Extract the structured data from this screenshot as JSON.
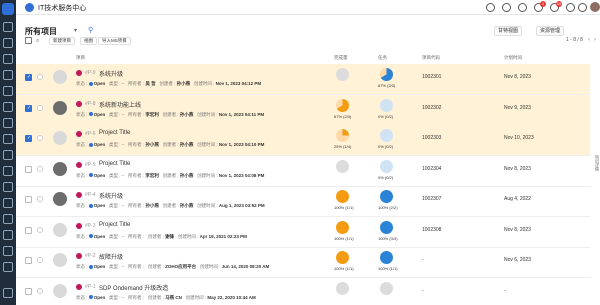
{
  "app": {
    "title": "IT技术服务中心"
  },
  "topbar": {
    "badge_1": "1",
    "badge_2": "10"
  },
  "header": {
    "title": "所有项目",
    "buttons": {
      "dashboard": "甘特视图",
      "resource": "资源管理"
    },
    "actions": {
      "new": "新建项目",
      "view": "视图",
      "import": "导入MS项目"
    },
    "pager": "1 - 8 / 8"
  },
  "columns": {
    "item": "项目",
    "progress": "完成量",
    "tasks": "任务",
    "code": "项目代码",
    "date": "计划时间"
  },
  "rows": [
    {
      "id": "#P-9",
      "title": "系统升级",
      "status": "Open",
      "type": "类型",
      "owner_label": "所有者",
      "owner": "吴 哲",
      "creator_label": "创建者",
      "creator": "孙小燕",
      "created_label": "创建时间",
      "created": "Nov 1, 2023 04:12 PM",
      "progress": "",
      "tasks": "67% (2/3)",
      "code": "1002301",
      "date": "Nov 8, 2023"
    },
    {
      "id": "#P-8",
      "title": "系统新功能上线",
      "status": "Open",
      "type": "类型",
      "owner_label": "所有者",
      "owner": "李宏利",
      "creator_label": "创建者",
      "creator": "孙小燕",
      "created_label": "创建时间",
      "created": "Nov 1, 2023 04:11 PM",
      "progress": "67% (2/3)",
      "tasks": "0% (0/2)",
      "code": "1002302",
      "date": "Nov 9, 2023"
    },
    {
      "id": "#P-6",
      "title": "Project Title",
      "status": "Open",
      "type": "类型",
      "owner_label": "所有者",
      "owner": "孙小燕",
      "creator_label": "创建者",
      "creator": "孙小燕",
      "created_label": "创建时间",
      "created": "Nov 1, 2023 04:10 PM",
      "progress": "25% (1/4)",
      "tasks": "0% (0/2)",
      "code": "1002303",
      "date": "Nov 10, 2023"
    },
    {
      "id": "#P-5",
      "title": "Project Title",
      "status": "Open",
      "type": "类型",
      "owner_label": "所有者",
      "owner": "李宏利",
      "creator_label": "创建者",
      "creator": "孙小燕",
      "created_label": "创建时间",
      "created": "Nov 1, 2023 04:08 PM",
      "progress": "",
      "tasks": "0% (0/2)",
      "code": "1002304",
      "date": "Nov 8, 2023"
    },
    {
      "id": "#P-4",
      "title": "系统升级",
      "status": "Open",
      "type": "类型",
      "owner_label": "所有者",
      "owner": "孙小燕",
      "creator_label": "创建者",
      "creator": "孙小燕",
      "created_label": "创建时间",
      "created": "Aug 1, 2023 03:52 PM",
      "progress": "100% (1/1)",
      "tasks": "100% (2/2)",
      "code": "1002307",
      "date": "Aug 4, 2022"
    },
    {
      "id": "#P-3",
      "title": "Project Title",
      "status": "Open",
      "type": "类型",
      "owner_label": "所有者",
      "owner": "",
      "creator_label": "创建者",
      "creator": "谢锋",
      "created_label": "创建时间",
      "created": "Apr 19, 2021 02:23 PM",
      "progress": "100% (1/1)",
      "tasks": "100% (3/3)",
      "code": "1002308",
      "date": "Nov 8, 2023"
    },
    {
      "id": "#P-2",
      "title": "故障升级",
      "status": "Open",
      "type": "类型",
      "owner_label": "所有者",
      "owner": "",
      "creator_label": "创建者",
      "creator": "ZOHO应用平台",
      "created_label": "创建时间",
      "created": "Jun 14, 2020 08:20 AM",
      "progress": "100% (1/1)",
      "tasks": "100% (1/1)",
      "code": "-",
      "date": "Nov 6, 2023"
    },
    {
      "id": "#P-1",
      "title": "SDP Ondemand 升级改造",
      "status": "Open",
      "type": "类型",
      "owner_label": "所有者",
      "owner": "",
      "creator_label": "创建者",
      "creator": "马燕 CN",
      "created_label": "创建时间",
      "created": "May 22, 2020 10:44 AM",
      "progress": "",
      "tasks": "",
      "code": "-",
      "date": "-"
    }
  ],
  "side_tab": "项目详情",
  "colors": {
    "accent": "#2f6fd6",
    "orange": "#f39c12",
    "blue": "#2a83d4",
    "selected_row": "#fff2d6"
  }
}
